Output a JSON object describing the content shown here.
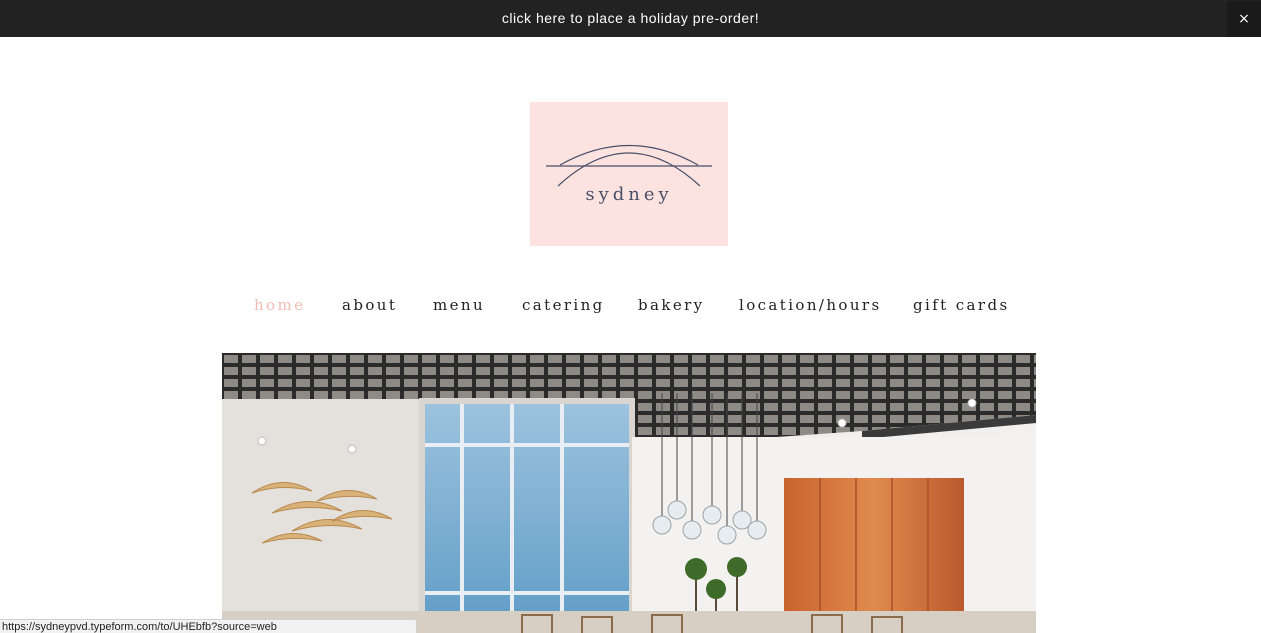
{
  "announcement": {
    "text": "click here to place a holiday pre-order!",
    "close_label": "×"
  },
  "logo": {
    "wordmark": "sydney",
    "background_color": "#fce3df",
    "ink_color": "#4a4f6a"
  },
  "nav": {
    "items": [
      {
        "label": "home",
        "active": true
      },
      {
        "label": "about",
        "active": false
      },
      {
        "label": "menu",
        "active": false
      },
      {
        "label": "catering",
        "active": false
      },
      {
        "label": "bakery",
        "active": false
      },
      {
        "label": "location/hours",
        "active": false
      },
      {
        "label": "gift cards",
        "active": false
      }
    ],
    "active_color": "#f2bcb4"
  },
  "hero": {
    "icon": "cafe-interior-photo"
  },
  "status_bar": {
    "url": "https://sydneypvd.typeform.com/to/UHEbfb?source=web"
  }
}
